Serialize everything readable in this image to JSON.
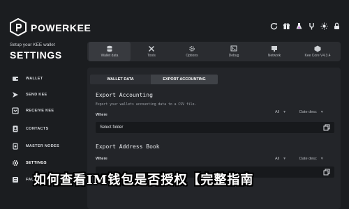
{
  "app": {
    "brand": "POWERKEE",
    "setup_text": "Setup your KEE wallet",
    "settings_heading": "SETTINGS"
  },
  "sidebar": {
    "items": [
      {
        "label": "WALLET",
        "icon": "wallet-icon"
      },
      {
        "label": "SEND KEE",
        "icon": "send-icon"
      },
      {
        "label": "RECEIVE KEE",
        "icon": "receive-icon"
      },
      {
        "label": "CONTACTS",
        "icon": "contacts-icon"
      },
      {
        "label": "MASTER NODES",
        "icon": "master-nodes-icon"
      },
      {
        "label": "SETTINGS",
        "icon": "settings-icon"
      },
      {
        "label": "FAQ",
        "icon": "faq-icon"
      }
    ]
  },
  "top_icons": [
    "refresh-icon",
    "gift-icon",
    "flask-icon",
    "tuning-fork-icon",
    "sun-icon",
    "padlock-icon"
  ],
  "tabs": [
    {
      "label": "Wallet data",
      "icon": "database-icon"
    },
    {
      "label": "Tools",
      "icon": "tools-icon"
    },
    {
      "label": "Options",
      "icon": "options-icon"
    },
    {
      "label": "Debug",
      "icon": "debug-icon"
    },
    {
      "label": "Network",
      "icon": "network-icon"
    },
    {
      "label": "Kee Core V4.3.4",
      "icon": "core-icon"
    }
  ],
  "subtabs": {
    "wallet": "WALLET DATA",
    "accounting": "EXPORT ACCOUNTING"
  },
  "export_accounting": {
    "title": "Export Accounting",
    "description": "Export your wallets accounting data to a CSV file.",
    "where_label": "Where",
    "filter_all": "All",
    "sort": "Date desc",
    "folder_placeholder": "Select folder"
  },
  "export_address": {
    "title": "Export Address Book",
    "where_label": "Where",
    "filter_all": "All",
    "sort": "Date desc"
  },
  "caption": "如何查看IM钱包是否授权【完整指南"
}
